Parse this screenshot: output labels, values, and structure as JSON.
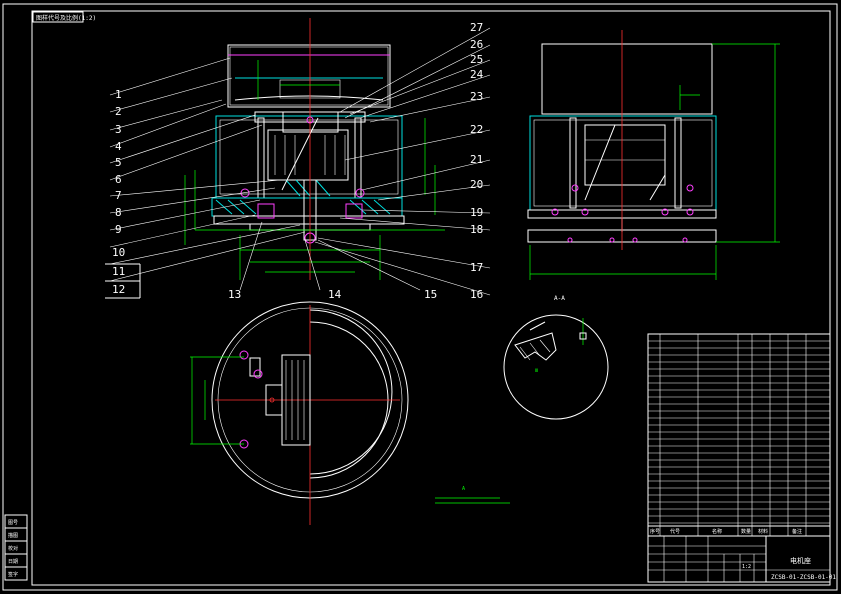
{
  "drawing": {
    "corner_tag": "图样代号及比例(1:2)",
    "part_numbers_left": [
      "1",
      "2",
      "3",
      "4",
      "5",
      "6",
      "7",
      "8",
      "9",
      "10",
      "11",
      "12"
    ],
    "part_numbers_right": [
      "27",
      "26",
      "25",
      "24",
      "23",
      "22",
      "21",
      "20",
      "19",
      "18",
      "17",
      "16"
    ],
    "part_numbers_bottom": [
      "13",
      "14",
      "15"
    ],
    "section_label": "A-A",
    "side_label": "A",
    "title_block": {
      "name": "电机座",
      "drawing_number": "ZCSB-01-ZCSB-01-01",
      "scale_label": "1:2"
    },
    "left_strip_labels": [
      "图号",
      "描图",
      "校对",
      "日期",
      "签字"
    ],
    "bom_header": [
      "序号",
      "代号",
      "名称",
      "数量",
      "材料",
      "备注"
    ]
  },
  "colors": {
    "background": "#000000",
    "outline": "#ffffff",
    "dimension": "#00ff00",
    "section": "#00e0e0",
    "centerline": "#ff3030",
    "highlight": "#ff40ff"
  }
}
